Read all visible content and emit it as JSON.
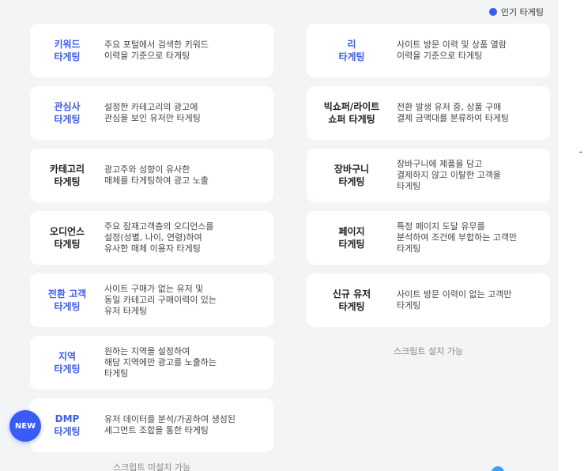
{
  "legend": {
    "label": "인기 타게팅",
    "color": "#3b5bf6"
  },
  "left_cards": [
    {
      "title": "키워드\n타게팅",
      "desc": "주요 포털에서 검색한 키워드\n이력을 기준으로 타게팅",
      "popular": true
    },
    {
      "title": "관심사\n타게팅",
      "desc": "설정한 카테고리의 광고에\n관심을 보인 유저만 타게팅",
      "popular": true
    },
    {
      "title": "카테고리\n타게팅",
      "desc": "광고주와 성향이 유사한\n매체를 타게팅하여 광고 노출",
      "popular": false
    },
    {
      "title": "오디언스\n타게팅",
      "desc": "주요 잠재고객층의 오디언스를\n설정(성별, 나이, 연령)하여\n유사한 매체 이용자 타게팅",
      "popular": false
    },
    {
      "title": "전환 고객\n타게팅",
      "desc": "사이트 구매가 없는 유저 및\n동일 카테고리 구매이력이 있는\n유저 타게팅",
      "popular": true
    },
    {
      "title": "지역\n타게팅",
      "desc": "원하는 지역을 설정하여\n해당 지역에만 광고를 노출하는\n타게팅",
      "popular": true
    },
    {
      "title": "DMP\n타게팅",
      "desc": "유저 데이터를 분석/가공하여 생성된\n세그먼트 조합을 통한 타게팅",
      "popular": true,
      "badge": "NEW"
    }
  ],
  "left_footnote": "스크립트 미설치 가능",
  "right_cards": [
    {
      "title": "리\n타게팅",
      "desc": "사이트 방문 이력 및 상품 열람\n이력을 기준으로 타게팅",
      "popular": true
    },
    {
      "title": "빅쇼퍼/라이트\n쇼퍼 타게팅",
      "desc": "전환 발생 유저 중, 상품 구매\n결제 금액대를 분류하여 타게팅",
      "popular": false
    },
    {
      "title": "장바구니\n타게팅",
      "desc": "장바구니에 제품을 담고\n결제하지 않고 이탈한 고객을\n타게팅",
      "popular": false
    },
    {
      "title": "페이지\n타게팅",
      "desc": "특정 페이지 도달 유무를\n분석하여 조건에 부합하는 고객만\n타게팅",
      "popular": false
    },
    {
      "title": "신규 유저\n타게팅",
      "desc": "사이트 방문 이력이 없는 고객만\n타게팅",
      "popular": false
    }
  ],
  "right_footnote": "스크립트 설치 가능"
}
